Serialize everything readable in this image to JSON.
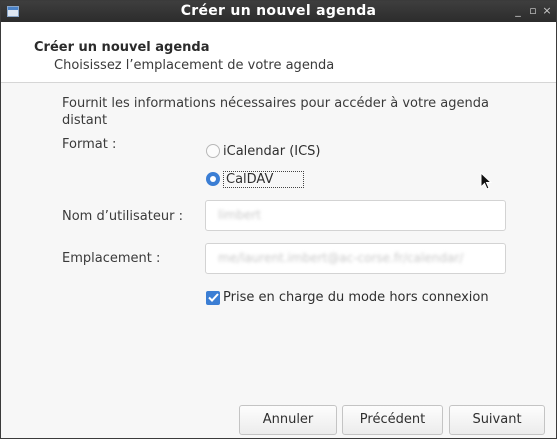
{
  "window": {
    "title": "Créer un nouvel agenda",
    "controls": {
      "minimize": "_",
      "maximize": "▫",
      "close": "×"
    }
  },
  "header": {
    "title": "Créer un nouvel agenda",
    "subtitle": "Choisissez l’emplacement de votre agenda"
  },
  "form": {
    "intro": "Fournit les informations nécessaires pour accéder à votre agenda distant",
    "format_label": "Format :",
    "format_options": [
      {
        "label": "iCalendar (ICS)",
        "selected": false
      },
      {
        "label": "CalDAV",
        "selected": true
      }
    ],
    "username_label": "Nom d’utilisateur :",
    "username_value": "limbert",
    "location_label": "Emplacement :",
    "location_value": "me/laurent.imbert@ac-corse.fr/calendar/",
    "offline_label": "Prise en charge du mode hors connexion",
    "offline_checked": true
  },
  "buttons": {
    "cancel": "Annuler",
    "previous": "Précédent",
    "next": "Suivant"
  },
  "colors": {
    "accent": "#3b7ed4",
    "titlebar": "#2f2f2f"
  }
}
